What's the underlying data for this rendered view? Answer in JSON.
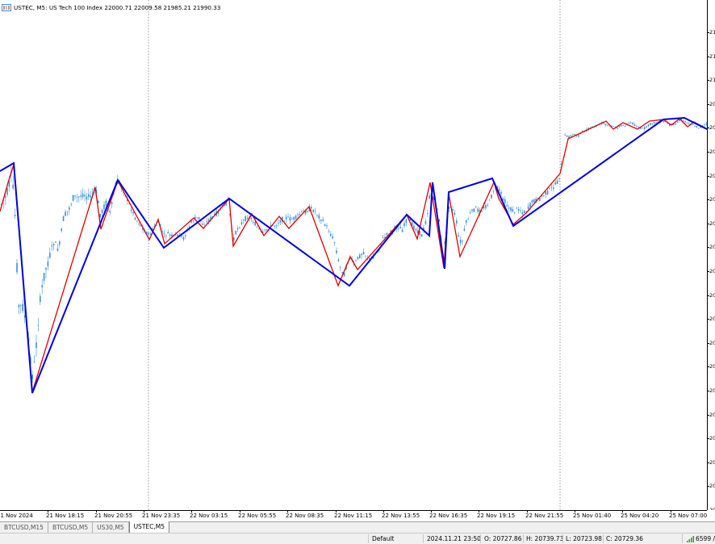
{
  "chart_header": {
    "text": "USTEC, M5:  US Tech 100 Index  22000.71 22009.58 21985.21 21990.33"
  },
  "price_axis": {
    "labels": [
      "21",
      "21",
      "21",
      "20",
      "20",
      "20",
      "20",
      "20",
      "20",
      "20",
      "20",
      "20",
      "20",
      "20",
      "20",
      "20",
      "20",
      "20",
      "20",
      "20",
      "20",
      "20"
    ]
  },
  "time_axis": {
    "labels": [
      "21 Nov 2024",
      "21 Nov 18:15",
      "21 Nov 20:55",
      "21 Nov 23:35",
      "22 Nov 03:15",
      "22 Nov 05:55",
      "22 Nov 08:35",
      "22 Nov 11:15",
      "22 Nov 13:55",
      "22 Nov 16:35",
      "22 Nov 19:15",
      "22 Nov 21:55",
      "25 Nov 01:40",
      "25 Nov 04:20",
      "25 Nov 07:00"
    ]
  },
  "tabs": [
    {
      "label": "BTCUSD,M15",
      "active": false
    },
    {
      "label": "BTCUSD,M5",
      "active": false
    },
    {
      "label": "US30,M5",
      "active": false
    },
    {
      "label": "USTEC,M5",
      "active": true
    }
  ],
  "status": {
    "profile": "Default",
    "datetime": "2024.11.21 23:50",
    "open": "O: 20727.86",
    "high": "H: 20739.73",
    "low": "L: 20723.98",
    "close": "C: 20729.36",
    "traffic": "6599 /"
  },
  "colors": {
    "candle": "#3d8fd1",
    "zigzag_major": "#0000e0",
    "zigzag_minor": "#e00000",
    "separator": "#808080"
  }
}
